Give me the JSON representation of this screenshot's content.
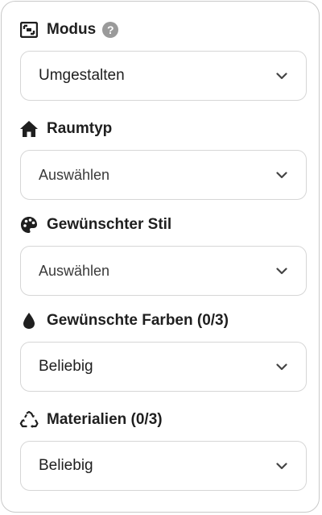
{
  "modus": {
    "label": "Modus",
    "help": "?",
    "value": "Umgestalten",
    "icon": "resize-icon"
  },
  "raumtyp": {
    "label": "Raumtyp",
    "value": "Auswählen",
    "icon": "home-icon"
  },
  "stil": {
    "label": "Gewünschter Stil",
    "value": "Auswählen",
    "icon": "palette-icon"
  },
  "farben": {
    "label": "Gewünschte Farben (0/3)",
    "value": "Beliebig",
    "icon": "droplet-icon"
  },
  "materialien": {
    "label": "Materialien (0/3)",
    "value": "Beliebig",
    "icon": "recycle-icon"
  }
}
